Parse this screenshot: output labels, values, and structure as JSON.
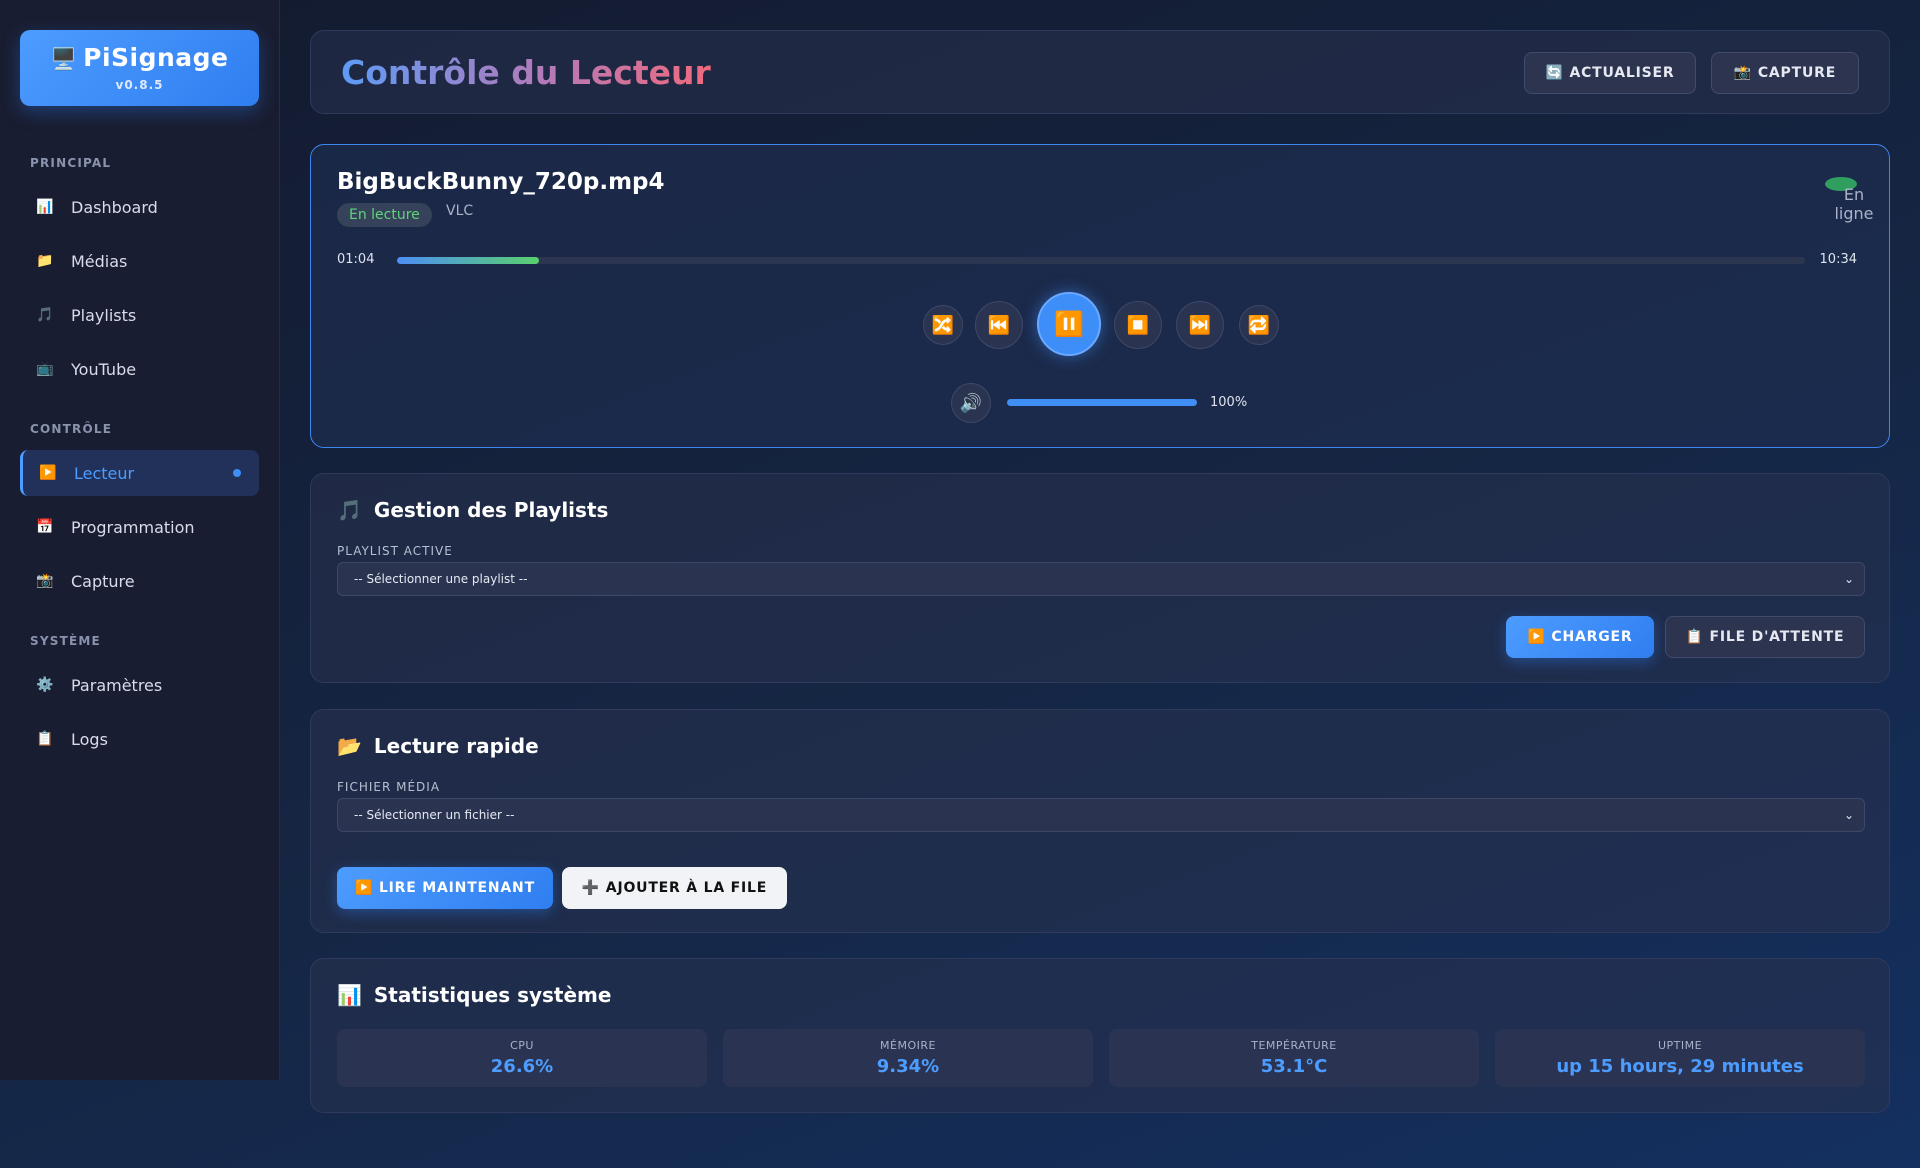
{
  "app": {
    "name": "PiSignage",
    "version": "v0.8.5",
    "logo_icon": "🖥️"
  },
  "sidebar": {
    "sections": [
      {
        "label": "PRINCIPAL"
      },
      {
        "label": "CONTRÔLE"
      },
      {
        "label": "SYSTÈME"
      }
    ],
    "items": [
      {
        "label": "Dashboard",
        "icon": "📊"
      },
      {
        "label": "Médias",
        "icon": "📁"
      },
      {
        "label": "Playlists",
        "icon": "🎵"
      },
      {
        "label": "YouTube",
        "icon": "📺"
      },
      {
        "label": "Lecteur",
        "icon": "▶️",
        "active": true
      },
      {
        "label": "Programmation",
        "icon": "📅"
      },
      {
        "label": "Capture",
        "icon": "📸"
      },
      {
        "label": "Paramètres",
        "icon": "⚙️"
      },
      {
        "label": "Logs",
        "icon": "📋"
      }
    ]
  },
  "header": {
    "title": "Contrôle du Lecteur",
    "refresh_label": "🔄 ACTUALISER",
    "capture_label": "📸 CAPTURE"
  },
  "player": {
    "file_name": "BigBuckBunny_720p.mp4",
    "state": "En lecture",
    "engine": "VLC",
    "online_label": "En ligne",
    "current_time": "01:04",
    "total_time": "10:34",
    "progress": 0.101,
    "controls": {
      "shuffle_icon": "🔀",
      "previous_icon": "⏮️",
      "pause_icon": "⏸️",
      "stop_icon": "⏹️",
      "next_icon": "⏭️",
      "repeat_icon": "🔁"
    },
    "volume_icon": "🔊",
    "volume_label": "100%",
    "volume": 1.0
  },
  "playlists": {
    "icon": "🎵",
    "title": "Gestion des Playlists",
    "field_label": "PLAYLIST ACTIVE",
    "select_value": "-- Sélectionner une playlist --",
    "load_label": "▶️ CHARGER",
    "queue_label": "📋 FILE D'ATTENTE"
  },
  "quick_play": {
    "icon": "📂",
    "title": "Lecture rapide",
    "field_label": "FICHIER MÉDIA",
    "select_value": "-- Sélectionner un fichier --",
    "play_now_label": "▶️ LIRE MAINTENANT",
    "add_queue_label": "➕ AJOUTER À LA FILE"
  },
  "stats": {
    "icon": "📊",
    "title": "Statistiques système",
    "items": [
      {
        "label": "CPU",
        "value": "26.6%"
      },
      {
        "label": "MÉMOIRE",
        "value": "9.34%"
      },
      {
        "label": "TEMPÉRATURE",
        "value": "53.1°C"
      },
      {
        "label": "UPTIME",
        "value": "up 15 hours, 29 minutes"
      }
    ]
  }
}
